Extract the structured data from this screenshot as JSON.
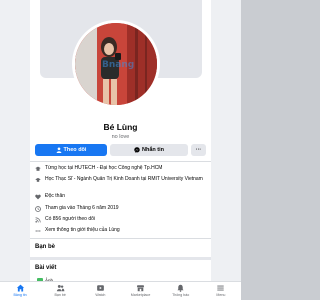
{
  "profile": {
    "name": "Bé Lùng",
    "tagline": "no love"
  },
  "actions": {
    "follow_label": "Theo dõi",
    "message_label": "Nhắn tin",
    "more_label": "···"
  },
  "info": [
    {
      "icon": "school-icon",
      "text": "Từng học tại HUTECH - Đại học Công nghệ Tp.HCM"
    },
    {
      "icon": "graduation-cap-icon",
      "text": "Học Thạc Sĩ - Ngành Quản Trị Kinh Doanh tại RMIT University Vietnam"
    },
    {
      "icon": "heart-icon",
      "text": "Độc thân"
    },
    {
      "icon": "clock-icon",
      "text": "Tham gia vào Tháng 6 năm 2019"
    },
    {
      "icon": "rss-icon",
      "text": "Có 856 người theo dõi"
    },
    {
      "icon": "more-dots-icon",
      "text": "Xem thông tin giới thiệu của Lùng"
    }
  ],
  "sections": {
    "friends": "Bạn bè",
    "posts": "Bài viết",
    "photos_chip": "Ảnh"
  },
  "watermark": "Bnang",
  "tabs": [
    {
      "label": "Bảng tin",
      "icon": "home-icon",
      "active": true
    },
    {
      "label": "Bạn bè",
      "icon": "friends-icon",
      "active": false
    },
    {
      "label": "Watch",
      "icon": "watch-icon",
      "active": false
    },
    {
      "label": "Marketplace",
      "icon": "marketplace-icon",
      "active": false
    },
    {
      "label": "Thông báo",
      "icon": "bell-icon",
      "active": false
    },
    {
      "label": "Menu",
      "icon": "menu-icon",
      "active": false
    }
  ],
  "colors": {
    "accent": "#1877f2",
    "secondary_button": "#e4e6eb",
    "muted_text": "#65676b"
  }
}
